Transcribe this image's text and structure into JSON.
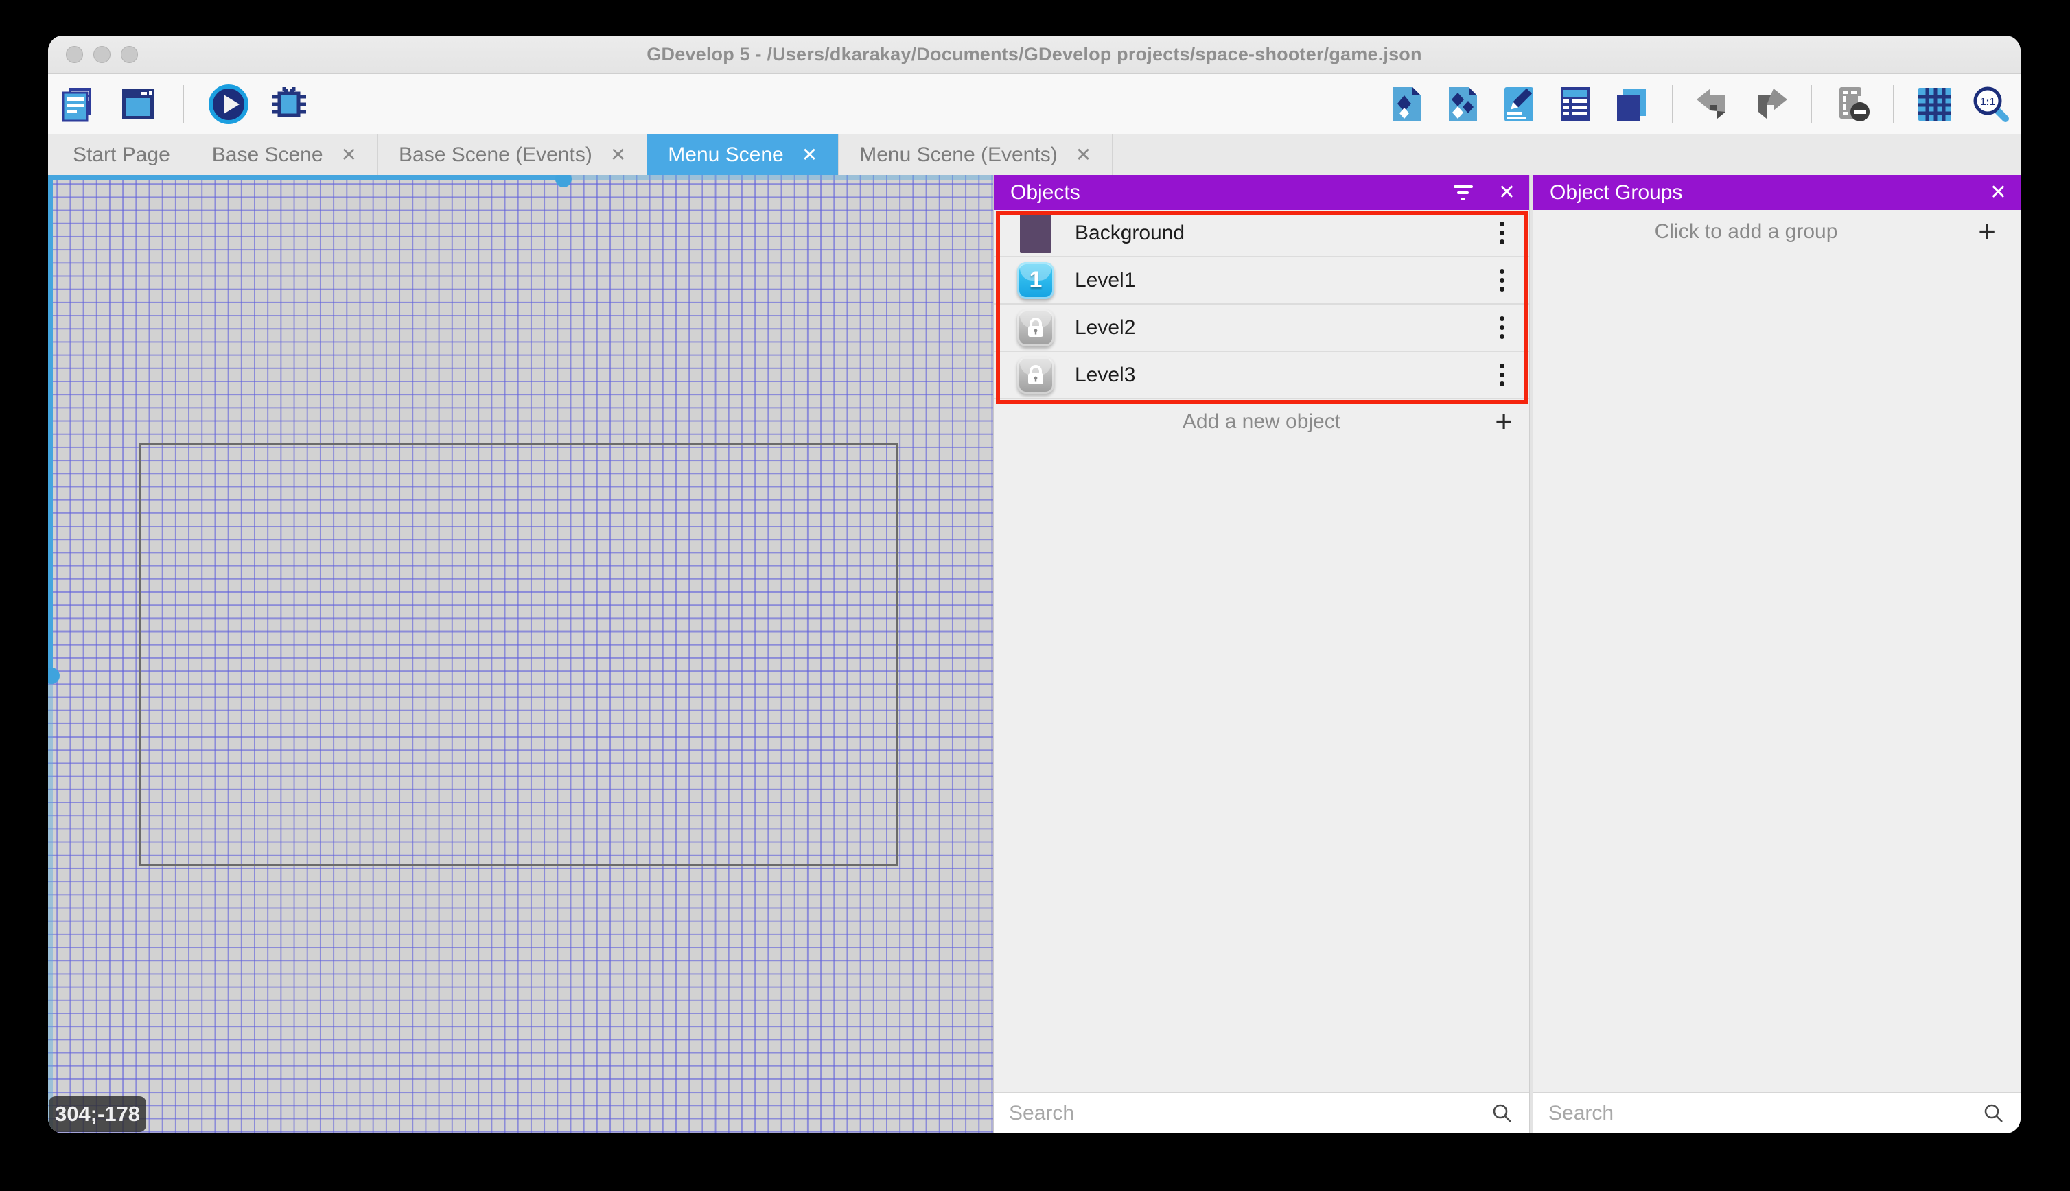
{
  "window": {
    "title": "GDevelop 5 - /Users/dkarakay/Documents/GDevelop projects/space-shooter/game.json"
  },
  "ui": {
    "close_glyph": "✕",
    "plus_glyph": "+"
  },
  "toolbar": {
    "left_icons": [
      "project-manager-icon",
      "scene-window-icon",
      "play-preview-icon",
      "debug-icon"
    ],
    "right_icons": [
      "objects-editor-icon",
      "object-groups-editor-icon",
      "properties-icon",
      "instances-list-icon",
      "layers-icon",
      "undo-icon",
      "redo-icon",
      "window-mask-icon",
      "grid-icon",
      "zoom-1to1-icon"
    ]
  },
  "tabs": [
    {
      "label": "Start Page",
      "closable": false,
      "active": false
    },
    {
      "label": "Base Scene",
      "closable": true,
      "active": false
    },
    {
      "label": "Base Scene (Events)",
      "closable": true,
      "active": false
    },
    {
      "label": "Menu Scene",
      "closable": true,
      "active": true
    },
    {
      "label": "Menu Scene (Events)",
      "closable": true,
      "active": false
    }
  ],
  "canvas": {
    "coordinates": "304;-178"
  },
  "objects_panel": {
    "title": "Objects",
    "items": [
      {
        "name": "Background",
        "icon": "color-swatch",
        "swatch_color": "#5a4769"
      },
      {
        "name": "Level1",
        "icon": "button-digit",
        "icon_label": "1"
      },
      {
        "name": "Level2",
        "icon": "lock-button"
      },
      {
        "name": "Level3",
        "icon": "lock-button"
      }
    ],
    "add_label": "Add a new object",
    "search_placeholder": "Search"
  },
  "groups_panel": {
    "title": "Object Groups",
    "empty_label": "Click to add a group",
    "search_placeholder": "Search"
  },
  "colors": {
    "accent_purple": "#9513cf",
    "active_tab_blue": "#49a9e5",
    "selection_blue": "#45a5de",
    "grid_line": "#6161db",
    "annotation_red": "#f5250e"
  }
}
